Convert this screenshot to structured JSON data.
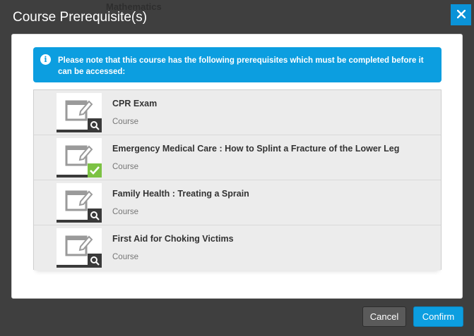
{
  "background": {
    "text": "Mathematics"
  },
  "modal": {
    "title": "Course Prerequisite(s)",
    "close_icon": "close-icon"
  },
  "alert": {
    "icon": "info-icon",
    "message": "Please note that this course has the following prerequisites which must be completed before it can be accessed:"
  },
  "courses": [
    {
      "title": "CPR Exam",
      "type": "Course",
      "status": "pending",
      "status_icon": "search-icon"
    },
    {
      "title": "Emergency Medical Care : How to Splint a Fracture of the Lower Leg",
      "type": "Course",
      "status": "completed",
      "status_icon": "checkmark-icon"
    },
    {
      "title": "Family Health : Treating a Sprain",
      "type": "Course",
      "status": "pending",
      "status_icon": "search-icon"
    },
    {
      "title": "First Aid for Choking Victims",
      "type": "Course",
      "status": "pending",
      "status_icon": "search-icon"
    }
  ],
  "footer": {
    "cancel_label": "Cancel",
    "confirm_label": "Confirm"
  },
  "colors": {
    "accent": "#0c9ee0",
    "completed": "#7cc243",
    "dark": "#3a3a3a"
  }
}
